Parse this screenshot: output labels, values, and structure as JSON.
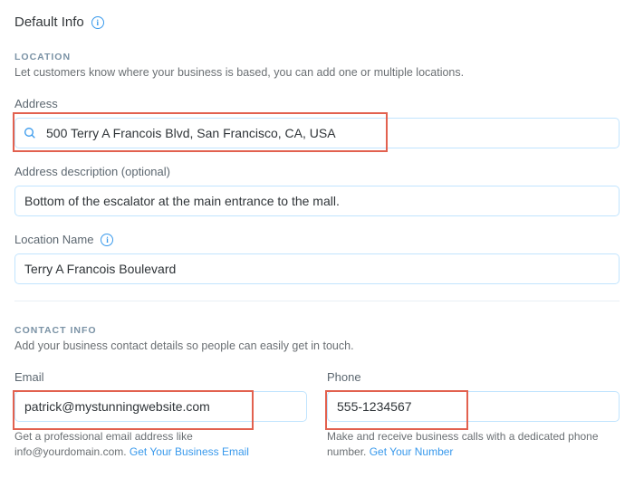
{
  "header": {
    "title": "Default Info"
  },
  "location": {
    "section_label": "LOCATION",
    "section_desc": "Let customers know where your business is based, you can add one or multiple locations.",
    "address_label": "Address",
    "address_value": "500 Terry A Francois Blvd, San Francisco, CA, USA",
    "desc_label": "Address description (optional)",
    "desc_value": "Bottom of the escalator at the main entrance to the mall.",
    "name_label": "Location Name",
    "name_value": "Terry A Francois Boulevard"
  },
  "contact": {
    "section_label": "CONTACT INFO",
    "section_desc": "Add your business contact details so people can easily get in touch.",
    "email_label": "Email",
    "email_value": "patrick@mystunningwebsite.com",
    "email_hint_pre": "Get a professional email address like info@yourdomain.com. ",
    "email_hint_link": "Get Your Business Email",
    "phone_label": "Phone",
    "phone_value": "555-1234567",
    "phone_hint_pre": "Make and receive business calls with a dedicated phone number. ",
    "phone_hint_link": "Get Your Number"
  }
}
